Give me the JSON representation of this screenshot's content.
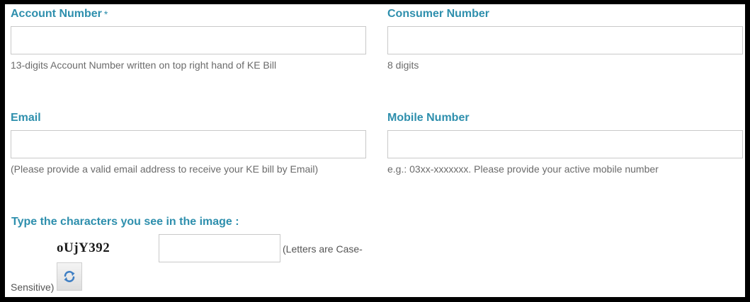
{
  "form": {
    "account_number": {
      "label": "Account Number",
      "required_mark": "*",
      "value": "",
      "hint": "13-digits Account Number written on top right hand of KE Bill"
    },
    "consumer_number": {
      "label": "Consumer Number",
      "value": "",
      "hint": "8 digits"
    },
    "email": {
      "label": "Email",
      "value": "",
      "hint": "(Please provide a valid email address to receive your KE bill by Email)"
    },
    "mobile_number": {
      "label": "Mobile Number",
      "value": "",
      "hint": "e.g.: 03xx-xxxxxxx. Please provide your active mobile number"
    },
    "captcha": {
      "label": "Type the characters you see in the image :",
      "image_text": "oUjY392",
      "value": "",
      "note_part1": "(Letters are Case-",
      "note_part2": "Sensitive)",
      "refresh_icon": "refresh-icon"
    }
  },
  "colors": {
    "label": "#2e8fad",
    "hint": "#6b6b6b",
    "input_border": "#c9c9c9",
    "refresh_arrows": "#3f7fc4",
    "frame": "#000000",
    "panel": "#ffffff"
  }
}
